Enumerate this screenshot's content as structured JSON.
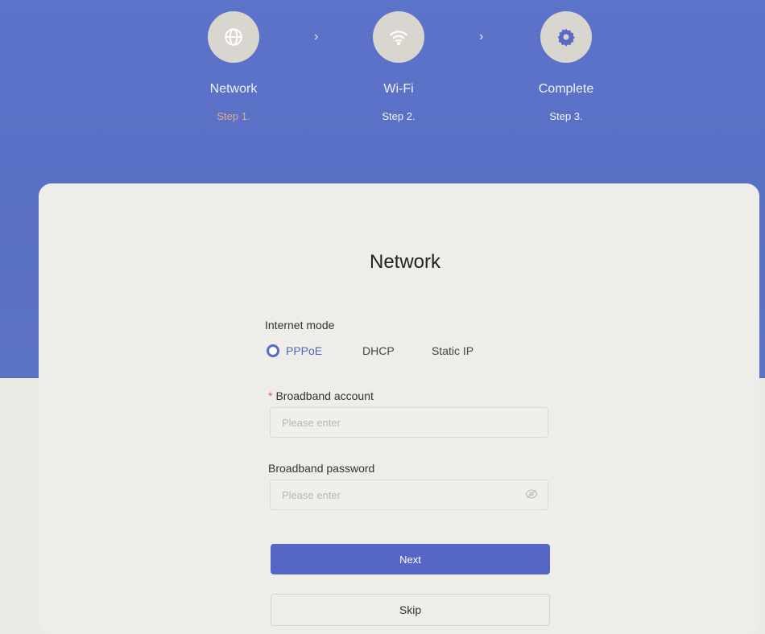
{
  "steps": [
    {
      "name": "Network",
      "step": "Step 1.",
      "icon": "globe-icon",
      "active": true
    },
    {
      "name": "Wi-Fi",
      "step": "Step 2.",
      "icon": "wifi-icon",
      "active": false
    },
    {
      "name": "Complete",
      "step": "Step 3.",
      "icon": "gear-icon",
      "active": false
    }
  ],
  "arrow_glyph": "›",
  "form": {
    "title": "Network",
    "mode_label": "Internet mode",
    "modes": [
      "PPPoE",
      "DHCP",
      "Static IP"
    ],
    "selected_mode": "PPPoE",
    "account": {
      "required_mark": "*",
      "label": "Broadband account",
      "placeholder": "Please enter"
    },
    "password": {
      "label": "Broadband password",
      "placeholder": "Please enter",
      "icon": "eye-icon"
    },
    "next_label": "Next",
    "skip_label": "Skip"
  },
  "colors": {
    "header_bg": "#5b73c9",
    "accent": "#5566c4",
    "active_step": "#e8a98a"
  }
}
